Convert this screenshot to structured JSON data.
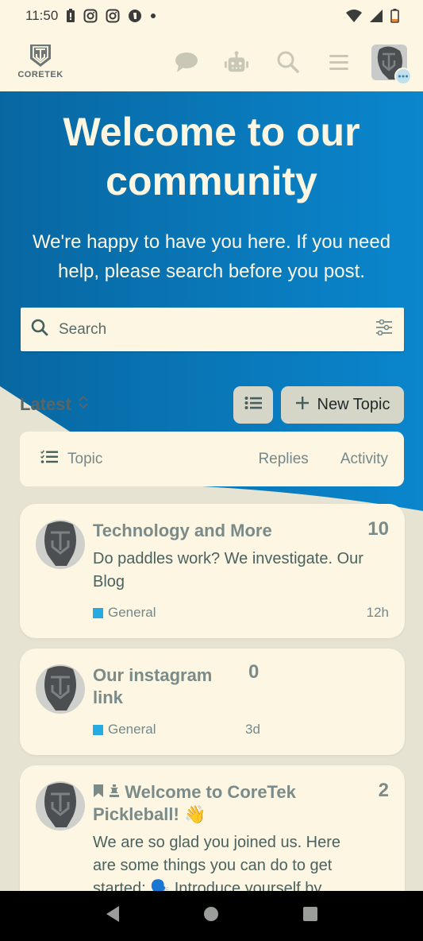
{
  "status_bar": {
    "time": "11:50",
    "left_icons": [
      "battery-alert-icon",
      "instagram-icon",
      "instagram-icon",
      "app-notification-icon",
      "dot-icon"
    ],
    "right_icons": [
      "wifi-icon",
      "signal-icon",
      "battery-low-icon"
    ]
  },
  "header": {
    "logo_text": "CORETEK",
    "icons": [
      "chat-icon",
      "robot-icon",
      "search-icon",
      "hamburger-menu-icon"
    ],
    "avatar_badge": "chat-bubble-dots-icon"
  },
  "hero": {
    "title": "Welcome to our community",
    "subtitle": "We're happy to have you here. If you need help, please search before you post.",
    "colors": {
      "gradient_start": "#0867a1",
      "gradient_end": "#0a86cd",
      "text": "#fcf6e2"
    }
  },
  "search": {
    "placeholder": "Search",
    "value": ""
  },
  "controls": {
    "sort_label": "Latest",
    "new_topic_label": "New Topic"
  },
  "list_header": {
    "topic": "Topic",
    "replies": "Replies",
    "activity": "Activity"
  },
  "topics": [
    {
      "title": "Technology and More",
      "excerpt": "Do paddles work? We investigate. Our Blog",
      "replies": "10",
      "category": "General",
      "category_color": "#25aae1",
      "age": "12h"
    },
    {
      "title": "Our instagram link",
      "excerpt": "",
      "replies": "0",
      "category": "General",
      "category_color": "#25aae1",
      "age": "3d"
    },
    {
      "title": "Welcome to CoreTek Pickleball! 👋",
      "status_icons": [
        "bookmark-icon",
        "pin-icon"
      ],
      "excerpt": "We are so glad you joined us. Here are some things you can do to get started: 🗣️ Introduce yourself by",
      "replies": "2"
    }
  ]
}
